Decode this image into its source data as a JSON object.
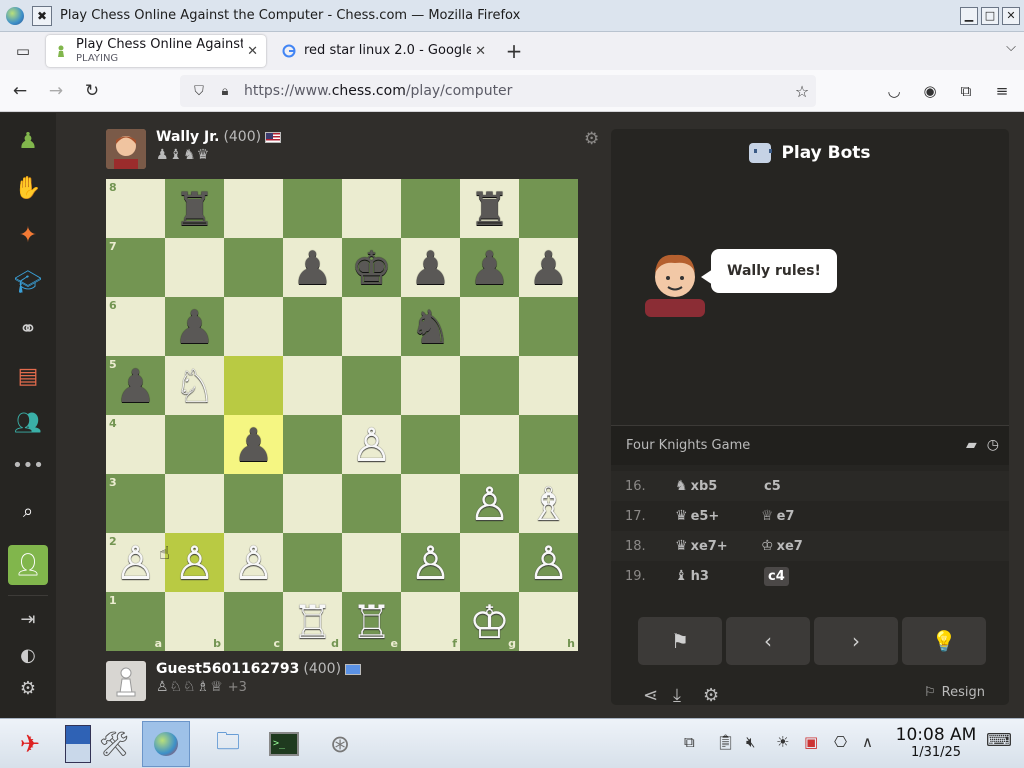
{
  "window": {
    "title": "Play Chess Online Against the Computer - Chess.com — Mozilla Firefox",
    "close_glyph": "✖",
    "controls": [
      "▁",
      "□",
      "✕"
    ]
  },
  "tabs": [
    {
      "title": "Play Chess Online Against",
      "subtitle": "PLAYING",
      "close": "✕"
    },
    {
      "title": "red star linux 2.0 - Google",
      "close": "✕"
    }
  ],
  "tabbar": {
    "new_tab": "+",
    "menu": "⌵"
  },
  "nav": {
    "back": "←",
    "forward": "→",
    "reload": "↻",
    "url_prefix": "https://www.",
    "url_host": "chess.com",
    "url_path": "/play/computer",
    "star": "☆"
  },
  "opponent": {
    "name": "Wally Jr.",
    "rating": "(400)",
    "captured": "♟♝♞♛"
  },
  "player": {
    "name": "Guest5601162793",
    "rating": "(400)",
    "captured": "♙♘♘♗♕",
    "advantage": "+3"
  },
  "board": {
    "ranks": [
      "8",
      "7",
      "6",
      "5",
      "4",
      "3",
      "2",
      "1"
    ],
    "files": [
      "a",
      "b",
      "c",
      "d",
      "e",
      "f",
      "g",
      "h"
    ],
    "squares": [
      [
        "",
        "♜",
        "",
        "",
        "",
        "",
        "♜",
        ""
      ],
      [
        "",
        "",
        "",
        "♟",
        "♚",
        "♟",
        "♟",
        "♟"
      ],
      [
        "",
        "♟",
        "",
        "",
        "",
        "♞",
        "",
        ""
      ],
      [
        "♟",
        "♘",
        "",
        "",
        "",
        "",
        "",
        ""
      ],
      [
        "",
        "",
        "♟",
        "",
        "♙",
        "",
        "",
        ""
      ],
      [
        "",
        "",
        "",
        "",
        "",
        "",
        "♙",
        "♗"
      ],
      [
        "♙",
        "♙",
        "♙",
        "",
        "",
        "♙",
        "",
        "♙"
      ],
      [
        "",
        "",
        "",
        "♖",
        "♖",
        "",
        "♔",
        ""
      ]
    ],
    "highlighted": [
      "c5",
      "c4",
      "b2"
    ]
  },
  "panel": {
    "title": "Play Bots",
    "bot_message": "Wally rules!",
    "opening": "Four Knights Game",
    "moves": [
      {
        "num": "16.",
        "white_fig": "♞",
        "white": "xb5",
        "black_fig": "",
        "black": "c5"
      },
      {
        "num": "17.",
        "white_fig": "♛",
        "white": "e5+",
        "black_fig": "♕",
        "black": "e7"
      },
      {
        "num": "18.",
        "white_fig": "♛",
        "white": "xe7+",
        "black_fig": "♔",
        "black": "xe7"
      },
      {
        "num": "19.",
        "white_fig": "♝",
        "white": "h3",
        "black_fig": "",
        "black": "c4"
      }
    ],
    "controls": [
      "⚑",
      "‹",
      "›",
      "💡"
    ],
    "resign": "Resign"
  },
  "taskbar": {
    "time": "10:08 AM",
    "date": "1/31/25"
  },
  "colors": {
    "board_light": "#ebecd0",
    "board_dark": "#739552",
    "chess_bg": "#302e2b",
    "accent_green": "#81b64c"
  }
}
